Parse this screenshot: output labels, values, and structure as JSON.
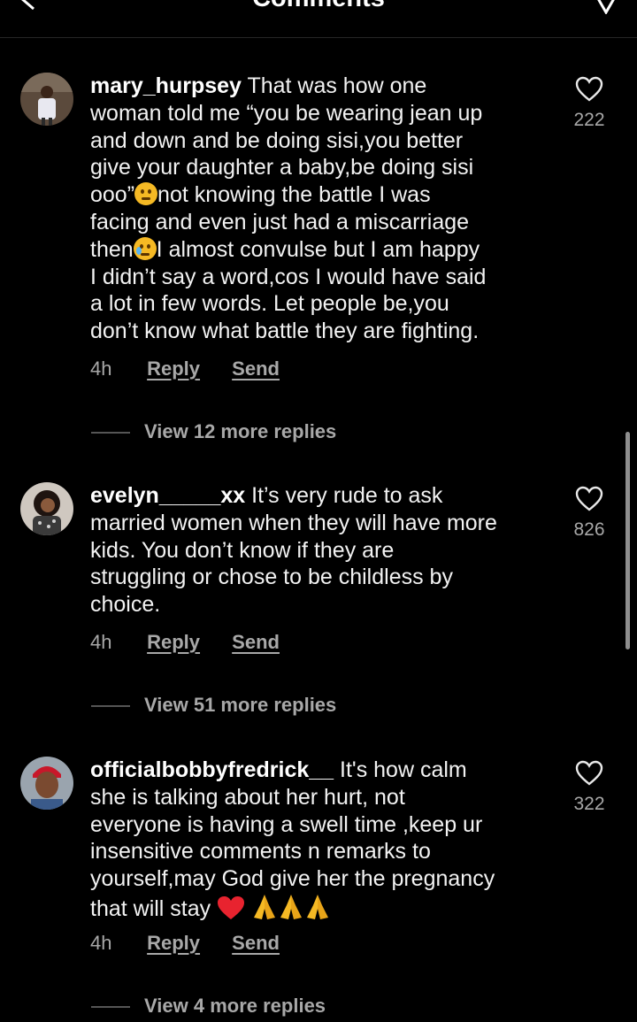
{
  "header": {
    "title": "Comments"
  },
  "comments": [
    {
      "username": "mary_hurpsey",
      "lines": [
        "That was how one",
        "woman told me “you be wearing jean up",
        "and down and be doing sisi,you better",
        "give  your daughter a baby,be doing sisi",
        "ooo”",
        "not knowing the battle I was",
        "facing and even just had a miscarriage",
        "then",
        "I almost convulse but I am happy",
        "I didn’t say a word,cos I would have said",
        "a lot in few words. Let people be,you",
        "don’t know what battle they are fighting."
      ],
      "likes": "222",
      "time": "4h",
      "reply_label": "Reply",
      "send_label": "Send",
      "view_replies": "View 12 more replies"
    },
    {
      "username": "evelyn_____xx",
      "lines": [
        "It’s very rude to ask",
        "married women when they will have more",
        "kids. You don’t know if they are",
        "struggling or chose to be childless by",
        "choice."
      ],
      "likes": "826",
      "time": "4h",
      "reply_label": "Reply",
      "send_label": "Send",
      "view_replies": "View 51 more replies"
    },
    {
      "username": "officialbobbyfredrick__",
      "lines": [
        "It's how calm",
        "she is talking about her hurt, not",
        "everyone is having a swell time ,keep ur",
        "insensitive comments n remarks to",
        "yourself,may God give her the pregnancy",
        "that will stay"
      ],
      "likes": "322",
      "time": "4h",
      "reply_label": "Reply",
      "send_label": "Send",
      "view_replies": "View 4 more replies"
    }
  ],
  "icons": {
    "back": "chevron-left-icon",
    "share": "paper-plane-icon",
    "like": "heart-outline-icon",
    "emoji_thinking": "thinking-face-icon",
    "emoji_crying": "crying-face-icon",
    "emoji_heart": "red-heart-icon",
    "emoji_pray": "folded-hands-icon"
  },
  "colors": {
    "background": "#000000",
    "text": "#f2f2f2",
    "secondary": "#a8a8a8"
  }
}
